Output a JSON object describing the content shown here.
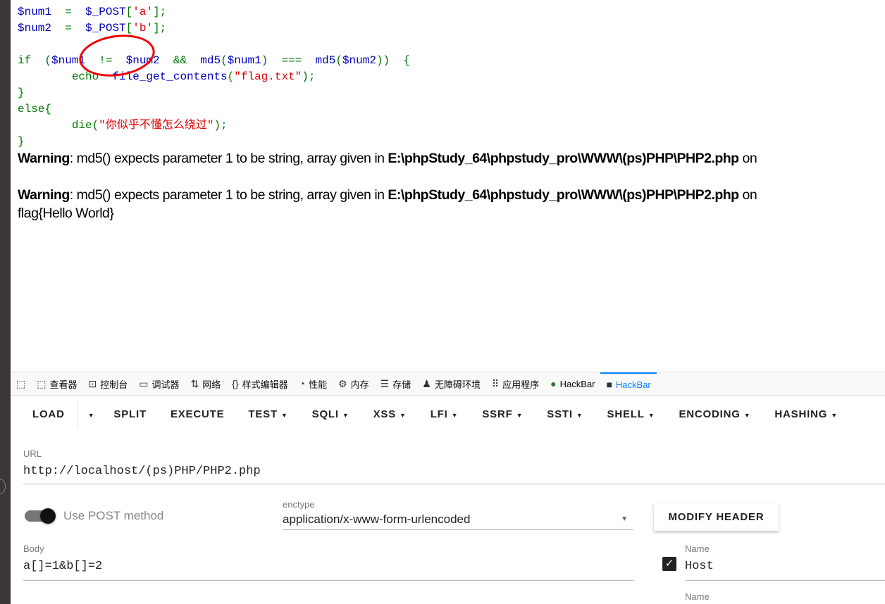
{
  "code_lines": [
    [
      {
        "t": "$num1",
        "c": "v"
      },
      {
        "t": "  =  ",
        "c": "k"
      },
      {
        "t": "$_POST",
        "c": "v"
      },
      {
        "t": "[",
        "c": "k"
      },
      {
        "t": "'a'",
        "c": "s"
      },
      {
        "t": "];",
        "c": "k"
      }
    ],
    [
      {
        "t": "$num2",
        "c": "v"
      },
      {
        "t": "  =  ",
        "c": "k"
      },
      {
        "t": "$_POST",
        "c": "v"
      },
      {
        "t": "[",
        "c": "k"
      },
      {
        "t": "'b'",
        "c": "s"
      },
      {
        "t": "];",
        "c": "k"
      }
    ],
    [
      {
        "t": " ",
        "c": "k"
      }
    ],
    [
      {
        "t": "if  (",
        "c": "k"
      },
      {
        "t": "$num1  ",
        "c": "v"
      },
      {
        "t": "!=  ",
        "c": "k"
      },
      {
        "t": "$num2  ",
        "c": "v"
      },
      {
        "t": "&&  ",
        "c": "k"
      },
      {
        "t": "md5",
        "c": "v"
      },
      {
        "t": "(",
        "c": "k"
      },
      {
        "t": "$num1",
        "c": "v"
      },
      {
        "t": ")  ===  ",
        "c": "k"
      },
      {
        "t": "md5",
        "c": "v"
      },
      {
        "t": "(",
        "c": "k"
      },
      {
        "t": "$num2",
        "c": "v"
      },
      {
        "t": "))  {",
        "c": "k"
      }
    ],
    [
      {
        "t": "        echo  ",
        "c": "k"
      },
      {
        "t": "file_get_contents",
        "c": "v"
      },
      {
        "t": "(",
        "c": "k"
      },
      {
        "t": "\"flag.txt\"",
        "c": "s"
      },
      {
        "t": ");",
        "c": "k"
      }
    ],
    [
      {
        "t": "}",
        "c": "k"
      }
    ],
    [
      {
        "t": "else{",
        "c": "k"
      }
    ],
    [
      {
        "t": "        die(",
        "c": "k"
      },
      {
        "t": "\"你似乎不懂怎么绕过\"",
        "c": "s"
      },
      {
        "t": ");",
        "c": "k"
      }
    ],
    [
      {
        "t": "}",
        "c": "k"
      }
    ]
  ],
  "warnings": [
    {
      "label": "Warning",
      "msg": ": md5() expects parameter 1 to be string, array given in ",
      "path": "E:\\phpStudy_64\\phpstudy_pro\\WWW\\(ps)PHP\\PHP2.php",
      "tail": " on"
    },
    {
      "label": "Warning",
      "msg": ": md5() expects parameter 1 to be string, array given in ",
      "path": "E:\\phpStudy_64\\phpstudy_pro\\WWW\\(ps)PHP\\PHP2.php",
      "tail": " on"
    }
  ],
  "output": "flag{Hello World}",
  "devtools_tabs": [
    {
      "icon": "⬚",
      "label": ""
    },
    {
      "icon": "⬚",
      "label": "查看器"
    },
    {
      "icon": "⊡",
      "label": "控制台"
    },
    {
      "icon": "▭",
      "label": "调试器"
    },
    {
      "icon": "⇅",
      "label": "网络"
    },
    {
      "icon": "{}",
      "label": "样式编辑器"
    },
    {
      "icon": "◔",
      "label": "性能"
    },
    {
      "icon": "⚙",
      "label": "内存"
    },
    {
      "icon": "☰",
      "label": "存储"
    },
    {
      "icon": "♟",
      "label": "无障碍环境"
    },
    {
      "icon": "⠿",
      "label": "应用程序"
    },
    {
      "icon": "●",
      "label": "HackBar"
    },
    {
      "icon": "■",
      "label": "HackBar"
    }
  ],
  "menu": [
    {
      "label": "LOAD",
      "dd": false
    },
    {
      "label": "",
      "dd": true
    },
    {
      "label": "SPLIT",
      "dd": false
    },
    {
      "label": "EXECUTE",
      "dd": false
    },
    {
      "label": "TEST",
      "dd": true
    },
    {
      "label": "SQLI",
      "dd": true
    },
    {
      "label": "XSS",
      "dd": true
    },
    {
      "label": "LFI",
      "dd": true
    },
    {
      "label": "SSRF",
      "dd": true
    },
    {
      "label": "SSTI",
      "dd": true
    },
    {
      "label": "SHELL",
      "dd": true
    },
    {
      "label": "ENCODING",
      "dd": true
    },
    {
      "label": "HASHING",
      "dd": true
    }
  ],
  "form": {
    "url_label": "URL",
    "url_value": "http://localhost/(ps)PHP/PHP2.php",
    "post_label": "Use POST method",
    "enctype_label": "enctype",
    "enctype_value": "application/x-www-form-urlencoded",
    "modify_header": "MODIFY HEADER",
    "body_label": "Body",
    "body_value": "a[]=1&b[]=2",
    "name_label": "Name",
    "name_value": "Host",
    "name_label2": "Name",
    "post_enabled": true,
    "header_checked": true
  }
}
